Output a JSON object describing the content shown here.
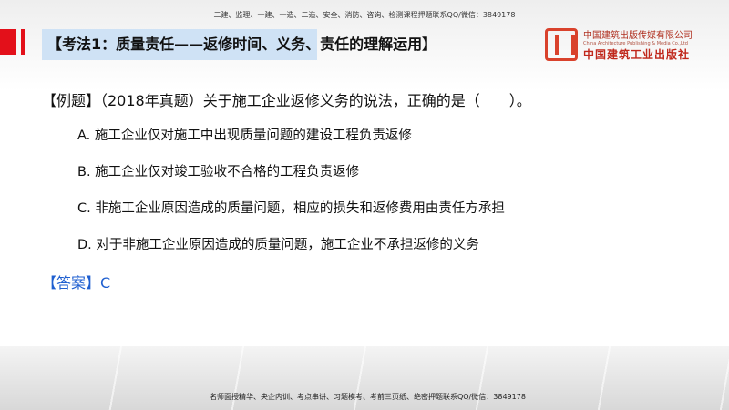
{
  "header": {
    "note": "二建、监理、一建、一造、二造、安全、消防、咨询、检测课程押题联系QQ/微信：3849178",
    "title": "【考法1：质量责任——返修时间、义务、责任的理解运用】"
  },
  "logo": {
    "cn": "中国建筑出版传媒有限公司",
    "en": "China Architecture Publishing & Media Co.,Ltd",
    "calligraphy": "中国建筑工业出版社"
  },
  "question": {
    "text": "【例题】（2018年真题）关于施工企业返修义务的说法，正确的是（　　）。",
    "options": [
      "A. 施工企业仅对施工中出现质量问题的建设工程负责返修",
      "B. 施工企业仅对竣工验收不合格的工程负责返修",
      "C. 非施工企业原因造成的质量问题，相应的损失和返修费用由责任方承担",
      "D. 对于非施工企业原因造成的质量问题，施工企业不承担返修的义务"
    ],
    "answer": "【答案】C"
  },
  "footer": {
    "note": "名师面授精华、央企内训、考点串讲、习题模考、考前三页纸、绝密押题联系QQ/微信：3849178"
  }
}
